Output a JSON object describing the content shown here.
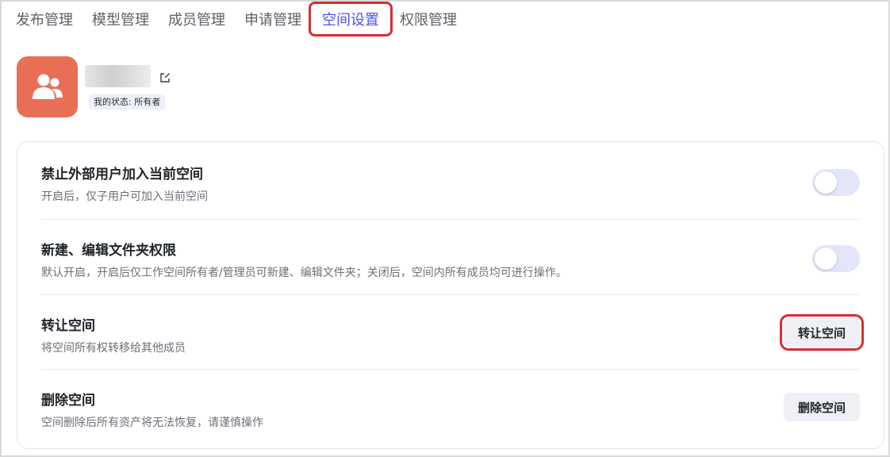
{
  "tabs": [
    {
      "label": "发布管理",
      "active": false
    },
    {
      "label": "模型管理",
      "active": false
    },
    {
      "label": "成员管理",
      "active": false
    },
    {
      "label": "申请管理",
      "active": false
    },
    {
      "label": "空间设置",
      "active": true
    },
    {
      "label": "权限管理",
      "active": false
    }
  ],
  "space": {
    "status_badge": "我的状态: 所有者",
    "avatar_icon": "users-icon",
    "avatar_color": "#e86f56"
  },
  "settings": [
    {
      "title": "禁止外部用户加入当前空间",
      "desc": "开启后，仅子用户可加入当前空间",
      "control": "toggle",
      "toggle_on": false
    },
    {
      "title": "新建、编辑文件夹权限",
      "desc": "默认开启，开启后仅工作空间所有者/管理员可新建、编辑文件夹；关闭后，空间内所有成员均可进行操作。",
      "control": "toggle",
      "toggle_on": false
    },
    {
      "title": "转让空间",
      "desc": "将空间所有权转移给其他成员",
      "control": "button",
      "button_label": "转让空间"
    },
    {
      "title": "删除空间",
      "desc": "空间删除后所有资产将无法恢复，请谨慎操作",
      "control": "button",
      "button_label": "删除空间"
    }
  ],
  "colors": {
    "accent": "#4d53e8",
    "highlight_border": "#d92e2e",
    "toggle_off": "#e3e6f8"
  }
}
